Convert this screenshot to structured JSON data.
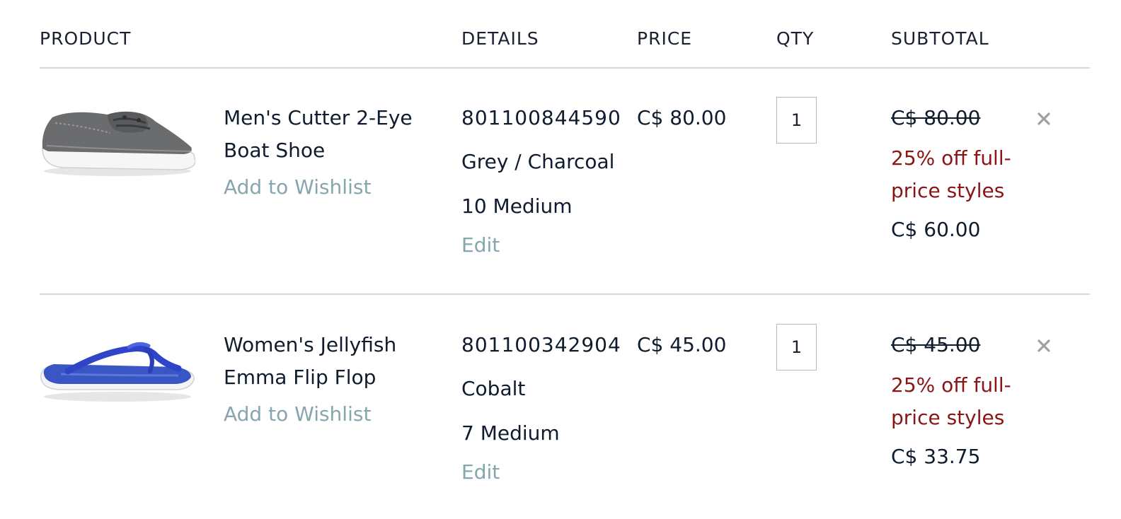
{
  "header": {
    "product": "PRODUCT",
    "details": "DETAILS",
    "price": "PRICE",
    "qty": "QTY",
    "subtotal": "SUBTOTAL"
  },
  "items": [
    {
      "name": "Men's Cutter 2-Eye Boat Shoe",
      "wishlist_label": "Add to Wishlist",
      "sku": "801100844590",
      "color": "Grey / Charcoal",
      "size": "10 Medium",
      "edit_label": "Edit",
      "price": "C$ 80.00",
      "qty": "1",
      "original_subtotal": "C$ 80.00",
      "promo": "25% off full-price styles",
      "subtotal": "C$ 60.00",
      "image_icon": "grey-boat-shoe"
    },
    {
      "name": "Women's Jellyfish Emma Flip Flop",
      "wishlist_label": "Add to Wishlist",
      "sku": "801100342904",
      "color": "Cobalt",
      "size": "7 Medium",
      "edit_label": "Edit",
      "price": "C$ 45.00",
      "qty": "1",
      "original_subtotal": "C$ 45.00",
      "promo": "25% off full-price styles",
      "subtotal": "C$ 33.75",
      "image_icon": "cobalt-flip-flop"
    }
  ],
  "colors": {
    "link": "#84a7ae",
    "promo": "#8b1414",
    "text": "#0f1c2e",
    "divider": "#d8d8d8"
  }
}
